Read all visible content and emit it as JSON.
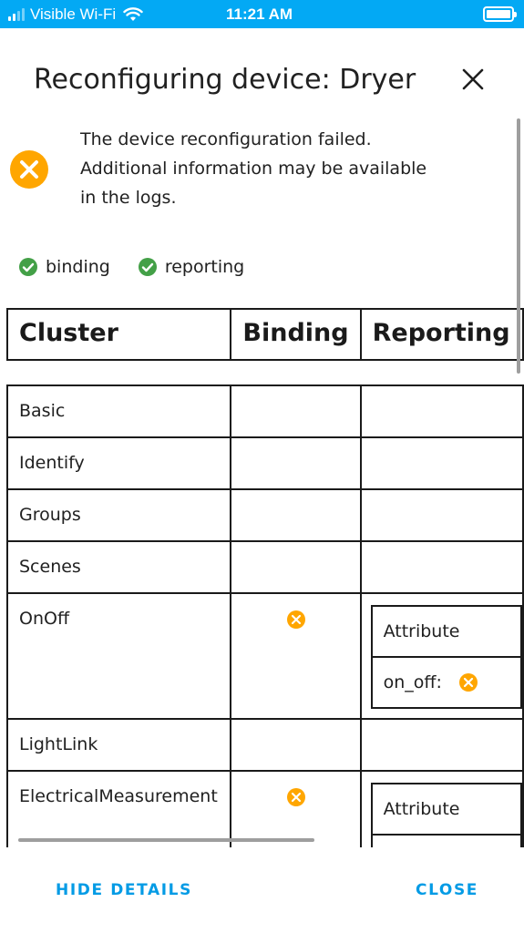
{
  "status_bar": {
    "carrier": "Visible Wi-Fi",
    "time": "11:21 AM",
    "wifi_icon": "wifi-icon",
    "battery_icon": "battery-icon"
  },
  "dialog": {
    "title": "Reconfiguring device: Dryer",
    "close_icon": "close-icon"
  },
  "alert": {
    "icon": "error-icon",
    "message": "The device reconfiguration failed.\nAdditional information may be available\nin the logs."
  },
  "status_chips": [
    {
      "label": "binding",
      "icon": "check-circle-icon"
    },
    {
      "label": "reporting",
      "icon": "check-circle-icon"
    }
  ],
  "table": {
    "headers": [
      "Cluster",
      "Binding",
      "Reporting"
    ],
    "rows": [
      {
        "cluster": "Basic"
      },
      {
        "cluster": "Identify"
      },
      {
        "cluster": "Groups"
      },
      {
        "cluster": "Scenes"
      },
      {
        "cluster": "OnOff",
        "binding_status": "error-icon",
        "reporting": {
          "header": "Attribute",
          "value": "on_off:",
          "status": "error-icon"
        }
      },
      {
        "cluster": "LightLink"
      },
      {
        "cluster": "ElectricalMeasurement",
        "binding_status": "error-icon",
        "reporting": {
          "header": "Attribute"
        }
      }
    ]
  },
  "footer": {
    "hide_details": "HIDE DETAILS",
    "close": "CLOSE"
  },
  "colors": {
    "status_bar": "#03a9f4",
    "accent": "#039be5",
    "error": "#ffa600",
    "success": "#43a047"
  }
}
